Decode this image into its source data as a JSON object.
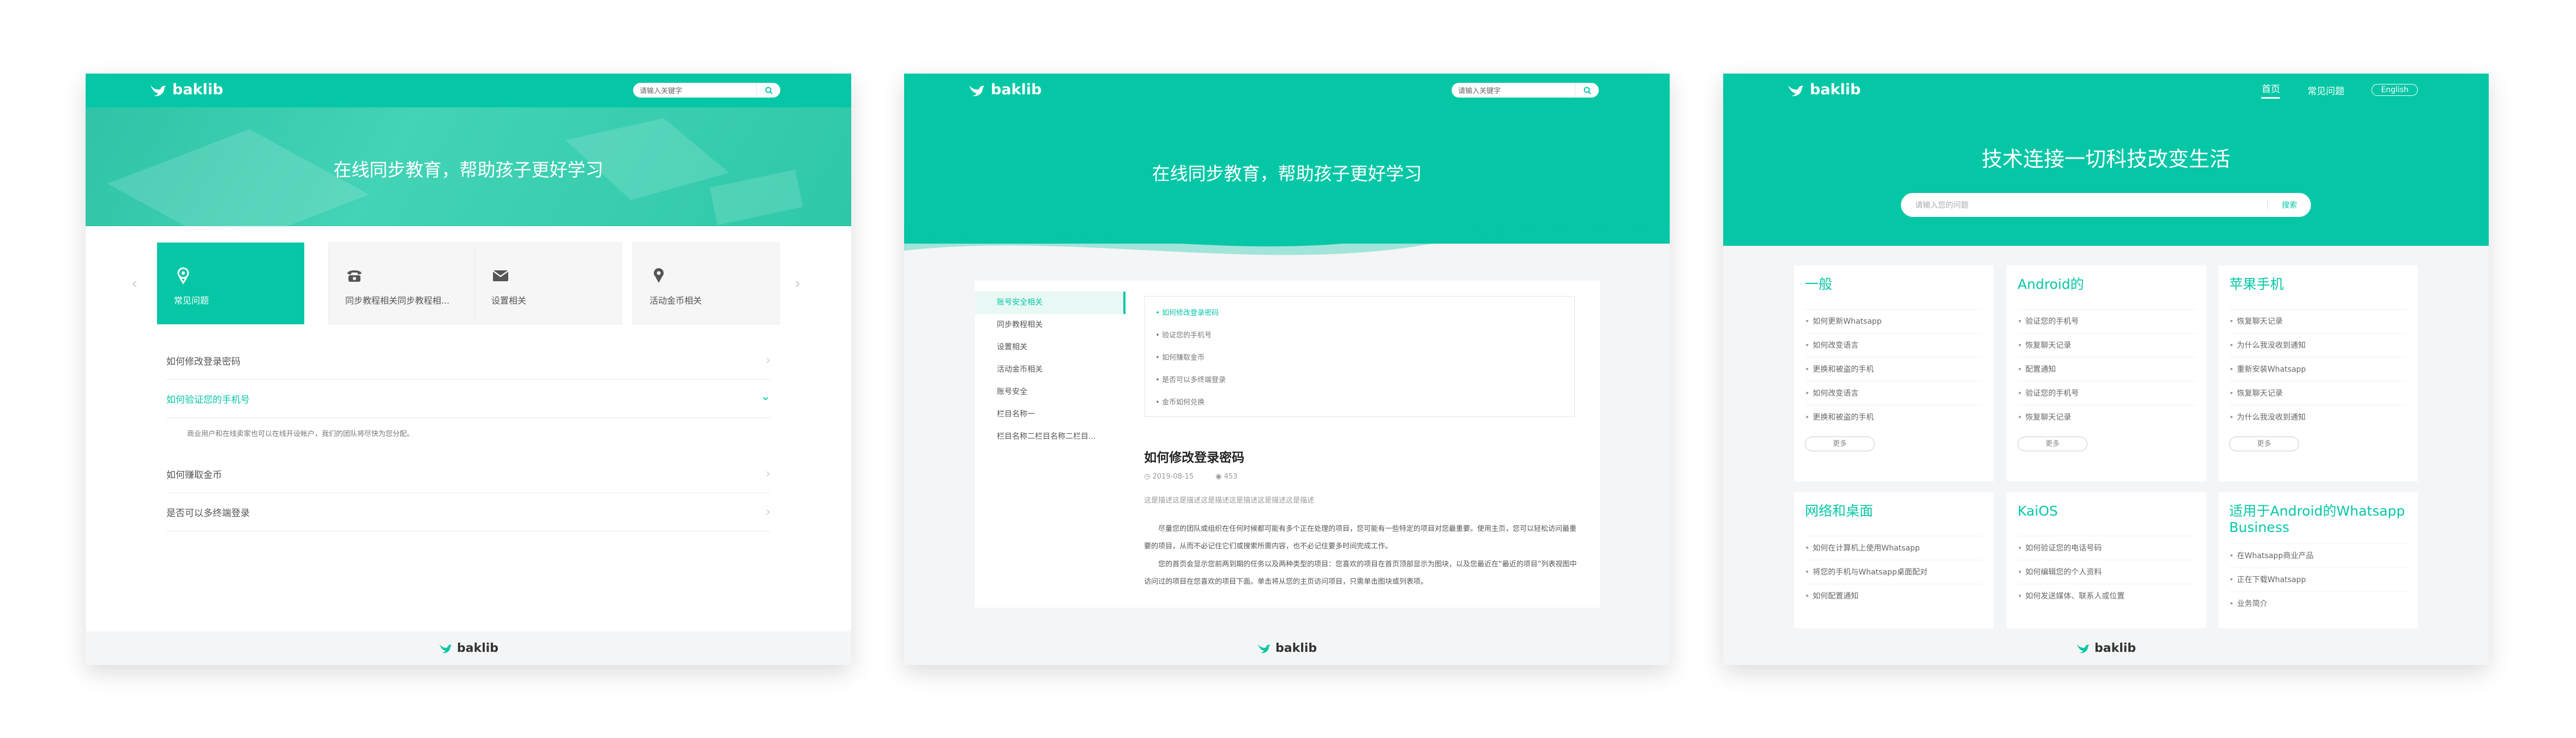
{
  "brand": "baklib",
  "colors": {
    "accent": "#05c7a6",
    "footer_bg": "#f4f5f6"
  },
  "panel1": {
    "search_placeholder": "请输入关键字",
    "hero_title": "在线同步教育，帮助孩子更好学习",
    "cards": [
      {
        "label": "常见问题",
        "icon": "pin-icon"
      },
      {
        "label": "同步教程相关同步教程相...",
        "icon": "phone-icon"
      },
      {
        "label": "设置相关",
        "icon": "mail-icon"
      },
      {
        "label": "活动金币相关",
        "icon": "location-icon"
      }
    ],
    "faqs": [
      {
        "q": "如何修改登录密码"
      },
      {
        "q": "如何验证您的手机号",
        "open": true
      },
      {
        "q": "如何赚取金币"
      },
      {
        "q": "是否可以多终端登录"
      }
    ],
    "answer": "商业用户和在线卖家也可以在线开设帐户，我们的团队将尽快为您分配。"
  },
  "panel2": {
    "search_placeholder": "请输入关键字",
    "hero_title": "在线同步教育，帮助孩子更好学习",
    "nav": [
      "账号安全相关",
      "同步教程相关",
      "设置相关",
      "活动金币相关",
      "账号安全",
      "栏目名称一",
      "栏目名称二栏目名称二栏目..."
    ],
    "sublist": [
      "如何修改登录密码",
      "验证您的手机号",
      "如何赚取金币",
      "是否可以多终端登录",
      "金币如何兑换"
    ],
    "article": {
      "title": "如何修改登录密码",
      "date": "2019-08-15",
      "views": "453",
      "summary": "这是描述这是描述这是描述这是描述这是描述这是描述",
      "para1": "尽量您的团队或组织在任何时候都可能有多个正在处理的项目，您可能有一些特定的项目对您最重要。使用主页，您可以轻松访问最重要的项目，从而不必记住它们或搜索所需内容，也不必记住要多时间完成工作。",
      "para2": "您的首页会显示您前两到期的任务以及两种类型的项目：您喜欢的项目在首页顶部显示为图块，以及您最近在“最近的项目”列表视图中访问过的项目在您喜欢的项目下面。单击将从您的主页访问项目，只需单击图块或列表项。"
    }
  },
  "panel3": {
    "nav": {
      "home": "首页",
      "faq": "常见问题",
      "lang": "English"
    },
    "hero_title": "技术连接一切科技改变生活",
    "search_placeholder": "请输入您的问题",
    "search_button": "搜索",
    "more_label": "更多",
    "categories": [
      {
        "title": "一般",
        "items": [
          "如何更新Whatsapp",
          "如何改变语言",
          "更换和被盗的手机",
          "如何改变语言",
          "更换和被盗的手机"
        ]
      },
      {
        "title": "Android的",
        "items": [
          "验证您的手机号",
          "恢复聊天记录",
          "配置通知",
          "验证您的手机号",
          "恢复聊天记录"
        ]
      },
      {
        "title": "苹果手机",
        "items": [
          "恢复聊天记录",
          "为什么我没收到通知",
          "重新安装Whatsapp",
          "恢复聊天记录",
          "为什么我没收到通知"
        ]
      },
      {
        "title": "网络和桌面",
        "items": [
          "如何在计算机上使用Whatsapp",
          "将您的手机与Whatsapp桌面配对",
          "如何配置通知"
        ]
      },
      {
        "title": "KaiOS",
        "items": [
          "如何验证您的电话号码",
          "如何编辑您的个人资料",
          "如何发送媒体、联系人或位置"
        ]
      },
      {
        "title": "适用于Android的Whatsapp Business",
        "items": [
          "在Whatsapp商业产品",
          "正在下载Whatsapp",
          "业务简介"
        ]
      }
    ]
  }
}
